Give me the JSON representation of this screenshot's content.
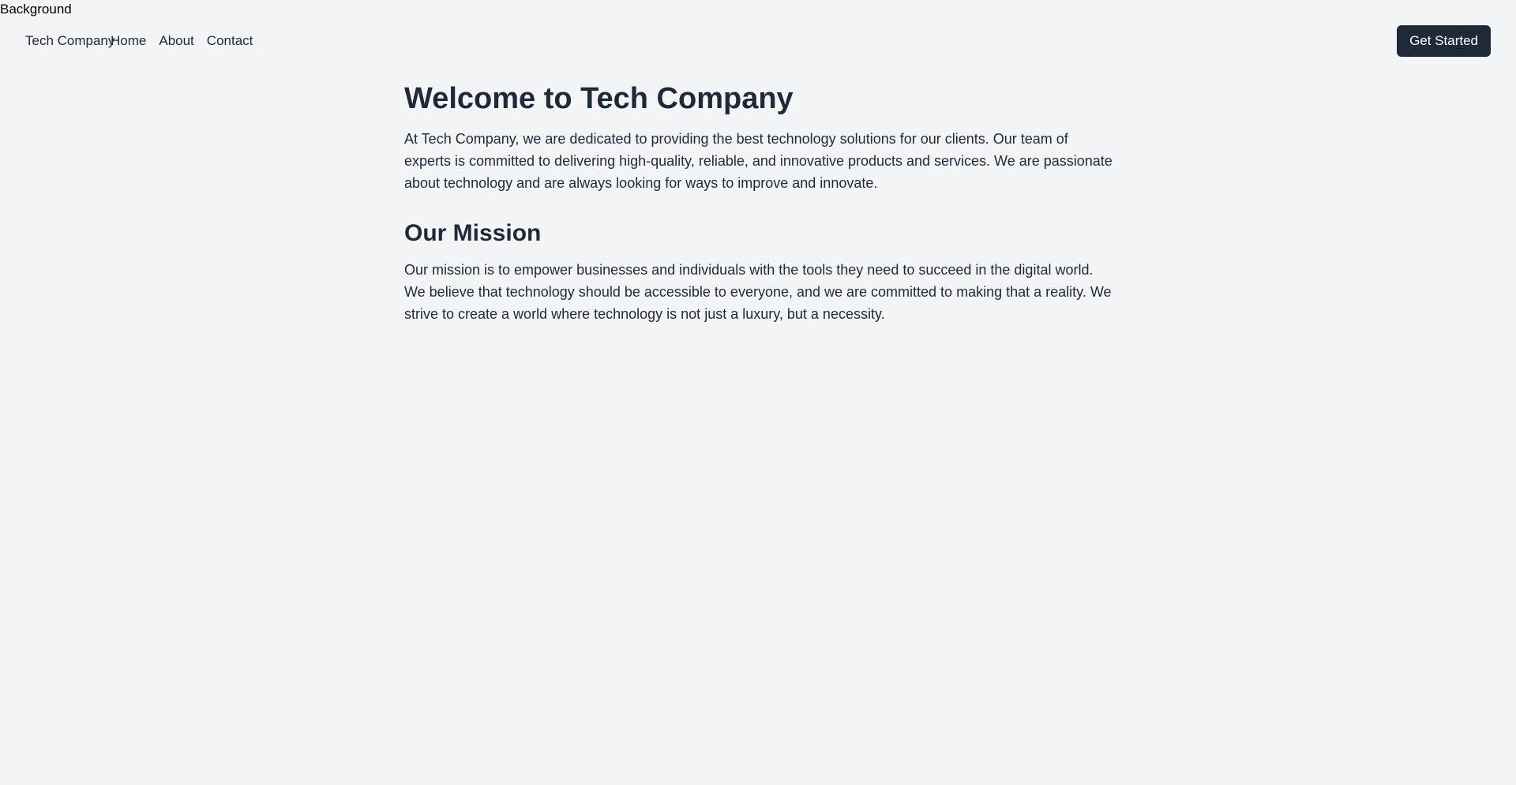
{
  "background_label": "Background",
  "nav": {
    "brand": "Tech Company",
    "links": [
      "Home",
      "About",
      "Contact"
    ],
    "cta": "Get Started"
  },
  "content": {
    "welcome_title": "Welcome to Tech Company",
    "welcome_text": "At Tech Company, we are dedicated to providing the best technology solutions for our clients. Our team of experts is committed to delivering high-quality, reliable, and innovative products and services. We are passionate about technology and are always looking for ways to improve and innovate.",
    "mission_title": "Our Mission",
    "mission_text": "Our mission is to empower businesses and individuals with the tools they need to succeed in the digital world. We believe that technology should be accessible to everyone, and we are committed to making that a reality. We strive to create a world where technology is not just a luxury, but a necessity."
  },
  "colors": {
    "background": "#f3f4f6",
    "text": "#1f2937",
    "button": "#1f2937",
    "button_text": "#ffffff"
  }
}
